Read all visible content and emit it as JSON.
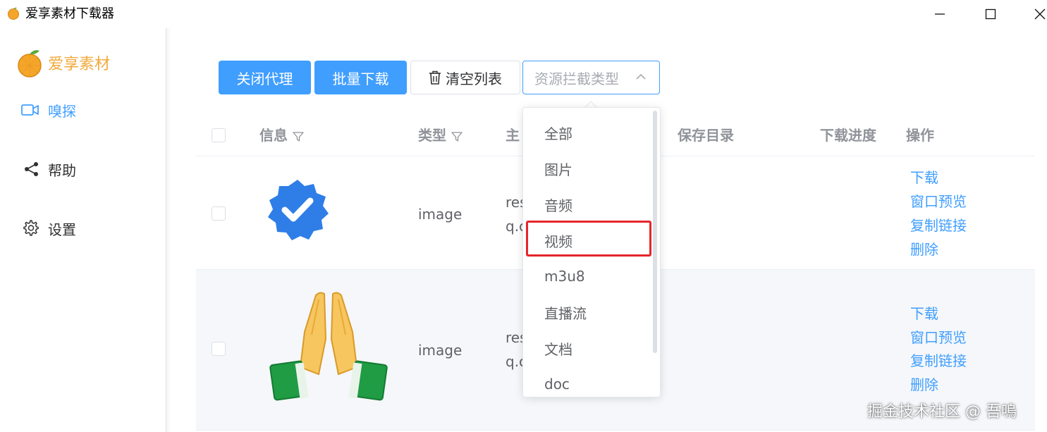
{
  "window": {
    "title": "爱享素材下载器",
    "controls": [
      "minimize",
      "maximize",
      "close"
    ]
  },
  "sidebar": {
    "logo_text": "爱享素材",
    "items": [
      {
        "label": "嗅探",
        "icon": "video-camera-icon",
        "active": true
      },
      {
        "label": "帮助",
        "icon": "share-icon",
        "active": false
      },
      {
        "label": "设置",
        "icon": "gear-icon",
        "active": false
      }
    ]
  },
  "toolbar": {
    "close_proxy_label": "关闭代理",
    "batch_download_label": "批量下载",
    "clear_list_label": "清空列表",
    "resource_type_placeholder": "资源拦截类型"
  },
  "table": {
    "headers": {
      "info": "信息",
      "type": "类型",
      "host": "主",
      "save_dir": "保存目录",
      "progress": "下载进度",
      "actions": "操作"
    },
    "rows": [
      {
        "thumbnail": "verified-badge-icon",
        "type": "image",
        "host_line1": "res",
        "host_line2": "q.c",
        "actions": [
          "下载",
          "窗口预览",
          "复制链接",
          "删除"
        ]
      },
      {
        "thumbnail": "folded-hands-icon",
        "type": "image",
        "host_line1": "res",
        "host_line2": "q.c",
        "actions": [
          "下载",
          "窗口预览",
          "复制链接",
          "删除"
        ]
      }
    ]
  },
  "dropdown": {
    "options": [
      "全部",
      "图片",
      "音频",
      "视频",
      "m3u8",
      "直播流",
      "文档",
      "doc"
    ],
    "highlighted": "视频"
  },
  "colors": {
    "primary": "#409eff",
    "logo": "#f2a93b",
    "highlight_border": "#e5262b"
  },
  "watermark": "掘金技术社区 @ 吾嗚"
}
